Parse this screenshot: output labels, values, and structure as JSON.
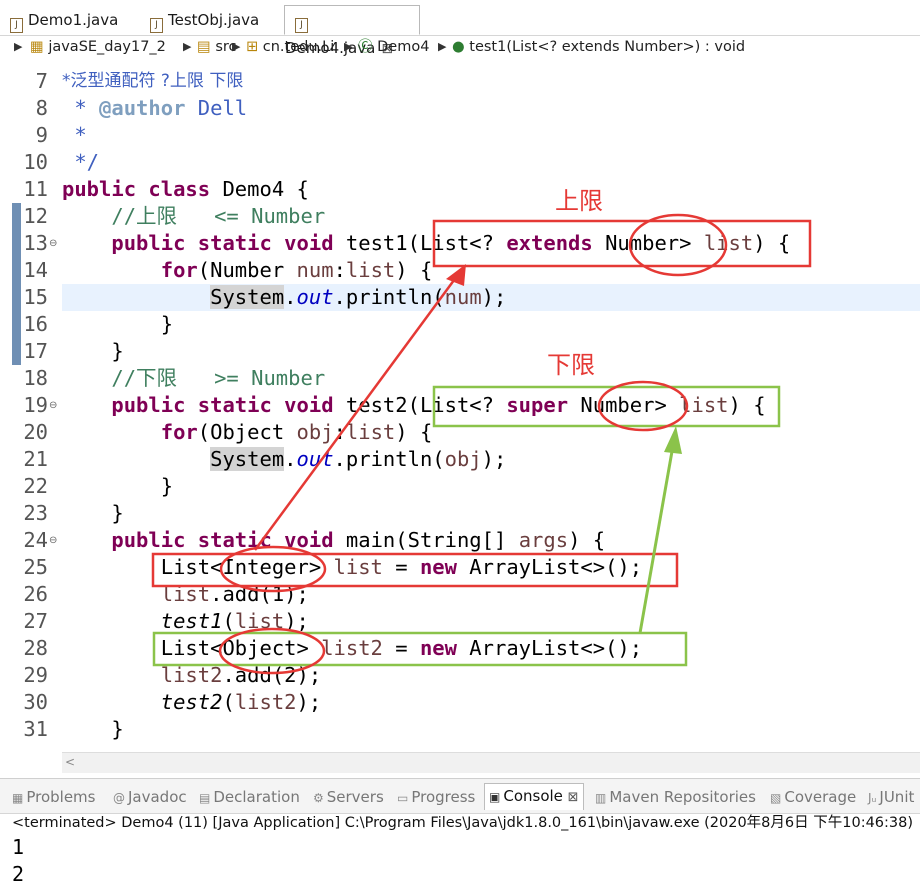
{
  "tabs": [
    {
      "label": "Demo1.java"
    },
    {
      "label": "TestObj.java"
    },
    {
      "label": "Demo4.java",
      "close": "⊠"
    }
  ],
  "breadcrumb": [
    "javaSE_day17_2",
    "src",
    "cn.tedu.Li",
    "Demo4",
    "test1(List<? extends Number>) : void"
  ],
  "code_lines": [
    {
      "num": "7",
      "text": "*泛型通配符 ?上限 下限"
    },
    {
      "num": "8",
      "text": " * @author Dell"
    },
    {
      "num": "9",
      "text": " *"
    },
    {
      "num": "10",
      "text": " */"
    },
    {
      "num": "11",
      "text": "public class Demo4 {"
    },
    {
      "num": "12",
      "text": "    //上限   <= Number"
    },
    {
      "num": "13",
      "text": "    public static void test1(List<? extends Number> list) {"
    },
    {
      "num": "14",
      "text": "        for(Number num:list) {"
    },
    {
      "num": "15",
      "text": "            System.out.println(num);"
    },
    {
      "num": "16",
      "text": "        }"
    },
    {
      "num": "17",
      "text": "    }"
    },
    {
      "num": "18",
      "text": "    //下限   >= Number"
    },
    {
      "num": "19",
      "text": "    public static void test2(List<? super Number> list) {"
    },
    {
      "num": "20",
      "text": "        for(Object obj:list) {"
    },
    {
      "num": "21",
      "text": "            System.out.println(obj);"
    },
    {
      "num": "22",
      "text": "        }"
    },
    {
      "num": "23",
      "text": "    }"
    },
    {
      "num": "24",
      "text": "    public static void main(String[] args) {"
    },
    {
      "num": "25",
      "text": "        List<Integer> list = new ArrayList<>();"
    },
    {
      "num": "26",
      "text": "        list.add(1);"
    },
    {
      "num": "27",
      "text": "        test1(list);"
    },
    {
      "num": "28",
      "text": "        List<Object> list2 = new ArrayList<>();"
    },
    {
      "num": "29",
      "text": "        list2.add(2);"
    },
    {
      "num": "30",
      "text": "        test2(list2);"
    },
    {
      "num": "31",
      "text": "    }"
    }
  ],
  "annotations": {
    "upper": "上限",
    "lower": "下限"
  },
  "view_tabs": [
    "Problems",
    "Javadoc",
    "Declaration",
    "Servers",
    "Progress",
    "Console",
    "Maven Repositories",
    "Coverage",
    "JUnit"
  ],
  "console": {
    "status": "<terminated> Demo4 (11) [Java Application] C:\\Program Files\\Java\\jdk1.8.0_161\\bin\\javaw.exe (2020年8月6日 下午10:46:38)",
    "output": [
      "1",
      "2"
    ]
  },
  "colors": {
    "keyword": "#7f0055",
    "comment": "#3f7f5f",
    "javadoc": "#3f5fbf",
    "red_annotation": "#e53935",
    "green_annotation": "#8bc34a",
    "current_line": "#e8f2fe"
  }
}
